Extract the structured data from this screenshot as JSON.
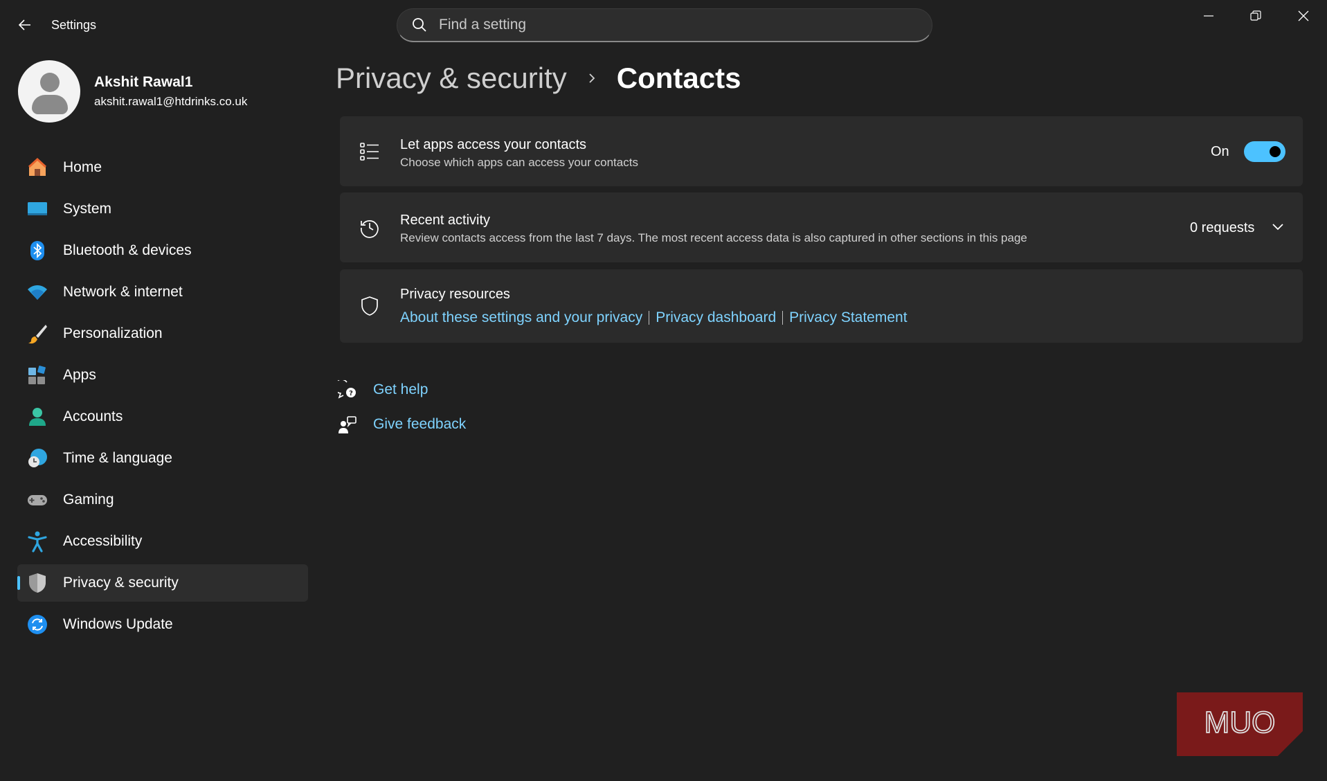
{
  "window": {
    "app_title": "Settings"
  },
  "search": {
    "placeholder": "Find a setting"
  },
  "profile": {
    "name": "Akshit Rawal1",
    "email": "akshit.rawal1@htdrinks.co.uk"
  },
  "sidebar": {
    "items": [
      {
        "label": "Home",
        "icon": "home-icon"
      },
      {
        "label": "System",
        "icon": "system-icon"
      },
      {
        "label": "Bluetooth & devices",
        "icon": "bluetooth-icon"
      },
      {
        "label": "Network & internet",
        "icon": "wifi-icon"
      },
      {
        "label": "Personalization",
        "icon": "brush-icon"
      },
      {
        "label": "Apps",
        "icon": "apps-icon"
      },
      {
        "label": "Accounts",
        "icon": "accounts-icon"
      },
      {
        "label": "Time & language",
        "icon": "globe-clock-icon"
      },
      {
        "label": "Gaming",
        "icon": "gamepad-icon"
      },
      {
        "label": "Accessibility",
        "icon": "accessibility-icon"
      },
      {
        "label": "Privacy & security",
        "icon": "shield-icon",
        "active": true
      },
      {
        "label": "Windows Update",
        "icon": "update-icon"
      }
    ],
    "accent_color": "#4cc2ff"
  },
  "breadcrumb": {
    "parent": "Privacy & security",
    "current": "Contacts"
  },
  "cards": {
    "contacts_access": {
      "title": "Let apps access your contacts",
      "subtitle": "Choose which apps can access your contacts",
      "toggle_label": "On",
      "toggle_on": true
    },
    "recent_activity": {
      "title": "Recent activity",
      "subtitle": "Review contacts access from the last 7 days. The most recent access data is also captured in other sections in this page",
      "requests": "0 requests"
    },
    "privacy_resources": {
      "title": "Privacy resources",
      "links": [
        "About these settings and your privacy",
        "Privacy dashboard",
        "Privacy Statement"
      ]
    }
  },
  "help": {
    "get_help": "Get help",
    "give_feedback": "Give feedback"
  },
  "watermark": {
    "text": "MUO"
  },
  "colors": {
    "background": "#202020",
    "card": "#2b2b2b",
    "link": "#7fd3ff",
    "toggle": "#4cc2ff"
  }
}
